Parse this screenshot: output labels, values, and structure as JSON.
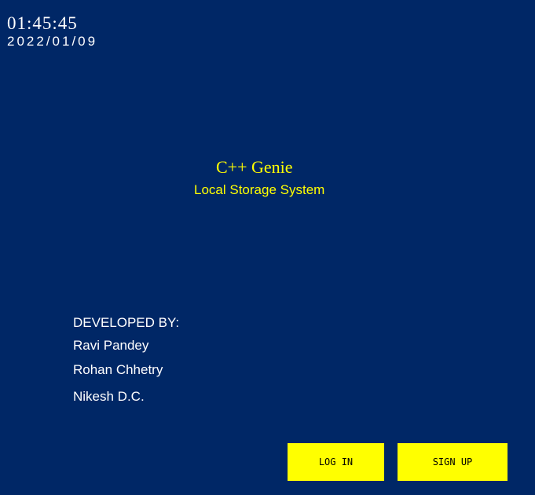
{
  "clock": {
    "time": "01:45:45",
    "date": "2022/01/09"
  },
  "app": {
    "title": "C++ Genie",
    "subtitle": "Local Storage System"
  },
  "credits": {
    "heading": "DEVELOPED BY:",
    "names": [
      "Ravi Pandey",
      "Rohan Chhetry",
      "Nikesh D.C."
    ]
  },
  "buttons": {
    "login_label": "LOG IN",
    "signup_label": "SIGN UP"
  },
  "colors": {
    "background": "#002766",
    "accent": "#ffff00",
    "text": "#ffffff"
  }
}
